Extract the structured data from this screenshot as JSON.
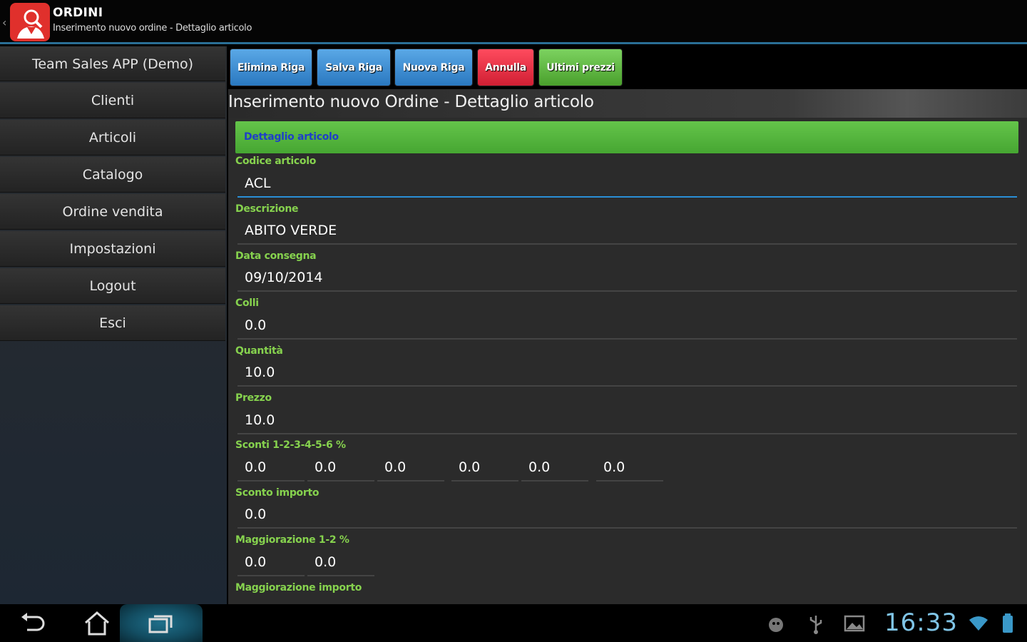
{
  "actionbar": {
    "title": "ORDINI",
    "subtitle": "Inserimento nuovo ordine - Dettaglio articolo"
  },
  "sidebar": {
    "items": [
      {
        "label": "Team Sales APP (Demo)"
      },
      {
        "label": "Clienti"
      },
      {
        "label": "Articoli"
      },
      {
        "label": "Catalogo"
      },
      {
        "label": "Ordine vendita"
      },
      {
        "label": "Impostazioni"
      },
      {
        "label": "Logout"
      },
      {
        "label": "Esci"
      }
    ]
  },
  "toolbar": {
    "elimina_label": "Elimina Riga",
    "salva_label": "Salva Riga",
    "nuova_label": "Nuova Riga",
    "annulla_label": "Annulla",
    "ultimi_label": "Ultimi prezzi"
  },
  "page": {
    "title": "Inserimento nuovo Ordine - Dettaglio articolo"
  },
  "form": {
    "section_title": "Dettaglio articolo",
    "codice_label": "Codice articolo",
    "codice_value": "ACL",
    "descrizione_label": "Descrizione",
    "descrizione_value": "ABITO VERDE",
    "data_label": "Data consegna",
    "data_value": "09/10/2014",
    "colli_label": "Colli",
    "colli_value": "0.0",
    "quantita_label": "Quantità",
    "quantita_value": "10.0",
    "prezzo_label": "Prezzo",
    "prezzo_value": "10.0",
    "sconti_label": "Sconti 1-2-3-4-5-6 %",
    "sconti_values": [
      "0.0",
      "0.0",
      "0.0",
      "0.0",
      "0.0",
      "0.0"
    ],
    "sconto_importo_label": "Sconto importo",
    "sconto_importo_value": "0.0",
    "maggiorazione_label": "Maggiorazione 1-2 %",
    "maggiorazione_values": [
      "0.0",
      "0.0"
    ],
    "maggiorazione_importo_label": "Maggiorazione importo"
  },
  "statusbar": {
    "clock": "16:33"
  },
  "colors": {
    "accent": "#2a6f96",
    "label_green": "#86d24e",
    "section_green": "#55b53c",
    "clock_blue": "#7fc4e6"
  },
  "icons": [
    "back-icon",
    "home-icon",
    "recent-apps-icon",
    "android-debug-icon",
    "usb-icon",
    "picture-icon",
    "wifi-icon",
    "battery-icon"
  ]
}
